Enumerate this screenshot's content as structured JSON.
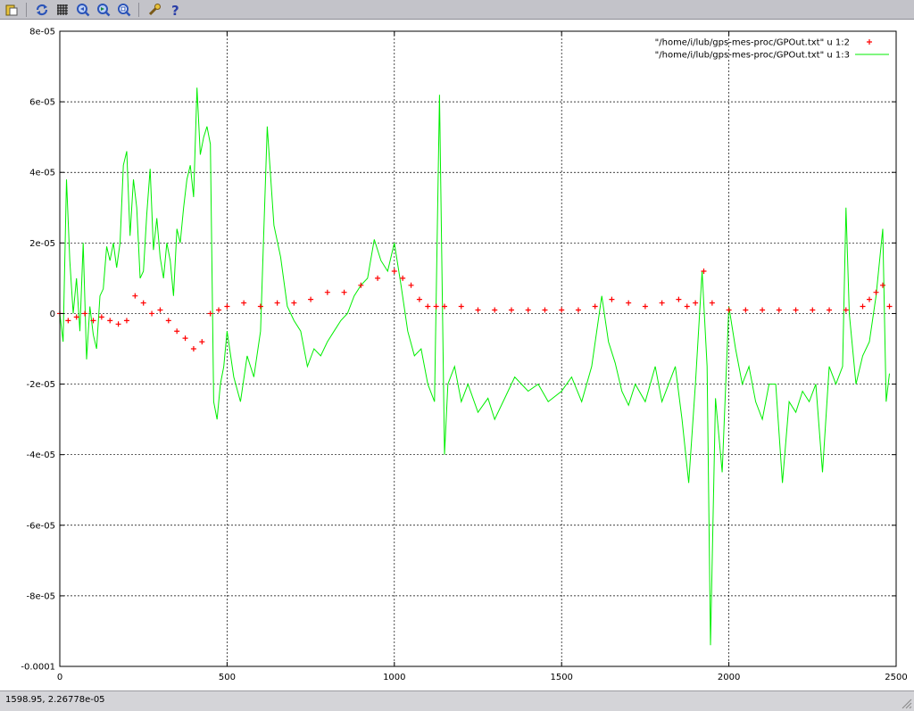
{
  "toolbar": {
    "buttons": [
      {
        "name": "copy-to-clipboard-icon"
      },
      {
        "name": "replot-icon"
      },
      {
        "name": "grid-icon"
      },
      {
        "name": "zoom-previous-icon"
      },
      {
        "name": "zoom-next-icon"
      },
      {
        "name": "zoom-unzoom-icon"
      },
      {
        "name": "options-icon"
      },
      {
        "name": "help-icon"
      }
    ],
    "colors": {
      "background": "#c3c3c9",
      "icon_blue": "#2b54b8",
      "icon_yellow": "#e8c23a"
    }
  },
  "status": {
    "coords": "1598.95,  2.26778e-05"
  },
  "chart_data": {
    "type": "line",
    "xlim": [
      0,
      2500
    ],
    "ylim": [
      -0.0001,
      8e-05
    ],
    "x_ticks": [
      "0",
      "500",
      "1000",
      "1500",
      "2000",
      "2500"
    ],
    "y_ticks": [
      "-0.0001",
      "-8e-05",
      "-6e-05",
      "-4e-05",
      "-2e-05",
      "0",
      "2e-05",
      "4e-05",
      "6e-05",
      "8e-05"
    ],
    "grid": true,
    "legend_position": "top-right",
    "series": [
      {
        "name": "\"/home/i/lub/gps-mes-proc/GPOut.txt\" u 1:2",
        "style": "points",
        "marker": "+",
        "color": "#ff0000",
        "x": [
          0,
          25,
          50,
          75,
          100,
          125,
          150,
          175,
          200,
          225,
          250,
          275,
          300,
          325,
          350,
          375,
          400,
          425,
          450,
          475,
          500,
          550,
          600,
          650,
          700,
          750,
          800,
          850,
          900,
          950,
          1000,
          1025,
          1050,
          1075,
          1100,
          1125,
          1150,
          1200,
          1250,
          1300,
          1350,
          1400,
          1450,
          1500,
          1550,
          1600,
          1650,
          1700,
          1750,
          1800,
          1850,
          1875,
          1900,
          1925,
          1950,
          2000,
          2050,
          2100,
          2150,
          2200,
          2250,
          2300,
          2350,
          2400,
          2420,
          2440,
          2460,
          2480
        ],
        "y": [
          0,
          -2e-06,
          -1e-06,
          0,
          -2e-06,
          -1e-06,
          -2e-06,
          -3e-06,
          -2e-06,
          5e-06,
          3e-06,
          0,
          1e-06,
          -2e-06,
          -5e-06,
          -7e-06,
          -1e-05,
          -8e-06,
          0,
          1e-06,
          2e-06,
          3e-06,
          2e-06,
          3e-06,
          3e-06,
          4e-06,
          6e-06,
          6e-06,
          8e-06,
          1e-05,
          1.2e-05,
          1e-05,
          8e-06,
          4e-06,
          2e-06,
          2e-06,
          2e-06,
          2e-06,
          1e-06,
          1e-06,
          1e-06,
          1e-06,
          1e-06,
          1e-06,
          1e-06,
          2e-06,
          4e-06,
          3e-06,
          2e-06,
          3e-06,
          4e-06,
          2e-06,
          3e-06,
          1.2e-05,
          3e-06,
          1e-06,
          1e-06,
          1e-06,
          1e-06,
          1e-06,
          1e-06,
          1e-06,
          1e-06,
          2e-06,
          4e-06,
          6e-06,
          8e-06,
          2e-06
        ]
      },
      {
        "name": "\"/home/i/lub/gps-mes-proc/GPOut.txt\" u 1:3",
        "style": "lines",
        "color": "#00ee00",
        "x": [
          0,
          10,
          20,
          30,
          40,
          50,
          60,
          70,
          80,
          90,
          100,
          110,
          120,
          130,
          140,
          150,
          160,
          170,
          180,
          190,
          200,
          210,
          220,
          230,
          240,
          250,
          260,
          270,
          280,
          290,
          300,
          310,
          320,
          330,
          340,
          350,
          360,
          370,
          380,
          390,
          400,
          410,
          420,
          430,
          440,
          450,
          460,
          470,
          480,
          490,
          500,
          520,
          540,
          560,
          580,
          600,
          620,
          640,
          660,
          680,
          700,
          720,
          740,
          760,
          780,
          800,
          820,
          840,
          860,
          880,
          900,
          920,
          940,
          960,
          980,
          1000,
          1020,
          1040,
          1060,
          1080,
          1100,
          1120,
          1135,
          1150,
          1160,
          1180,
          1200,
          1220,
          1250,
          1280,
          1300,
          1330,
          1360,
          1400,
          1430,
          1460,
          1500,
          1530,
          1560,
          1590,
          1620,
          1640,
          1660,
          1680,
          1700,
          1720,
          1750,
          1780,
          1800,
          1820,
          1840,
          1860,
          1880,
          1900,
          1920,
          1935,
          1945,
          1960,
          1980,
          2000,
          2020,
          2040,
          2060,
          2080,
          2100,
          2120,
          2140,
          2160,
          2180,
          2200,
          2220,
          2240,
          2260,
          2280,
          2300,
          2320,
          2340,
          2350,
          2360,
          2380,
          2400,
          2420,
          2440,
          2460,
          2470,
          2480
        ],
        "y": [
          0,
          -8e-06,
          3.8e-05,
          1.5e-05,
          0,
          1e-05,
          -5e-06,
          2e-05,
          -1.3e-05,
          2e-06,
          -6e-06,
          -1e-05,
          5e-06,
          7e-06,
          1.9e-05,
          1.5e-05,
          2e-05,
          1.3e-05,
          2e-05,
          4.2e-05,
          4.6e-05,
          2.2e-05,
          3.8e-05,
          3e-05,
          1e-05,
          1.2e-05,
          2.8e-05,
          4.1e-05,
          1.8e-05,
          2.7e-05,
          1.6e-05,
          1e-05,
          2e-05,
          1.5e-05,
          5e-06,
          2.4e-05,
          2e-05,
          3e-05,
          3.8e-05,
          4.2e-05,
          3.3e-05,
          6.4e-05,
          4.5e-05,
          5e-05,
          5.3e-05,
          4.8e-05,
          -2.5e-05,
          -3e-05,
          -2e-05,
          -1.5e-05,
          -5e-06,
          -1.8e-05,
          -2.5e-05,
          -1.2e-05,
          -1.8e-05,
          -5e-06,
          5.3e-05,
          2.5e-05,
          1.6e-05,
          2e-06,
          -2e-06,
          -5e-06,
          -1.5e-05,
          -1e-05,
          -1.2e-05,
          -8e-06,
          -5e-06,
          -2e-06,
          0,
          5e-06,
          8e-06,
          1e-05,
          2.1e-05,
          1.5e-05,
          1.2e-05,
          2e-05,
          8e-06,
          -5e-06,
          -1.2e-05,
          -1e-05,
          -2e-05,
          -2.5e-05,
          6.2e-05,
          -4e-05,
          -2e-05,
          -1.5e-05,
          -2.5e-05,
          -2e-05,
          -2.8e-05,
          -2.4e-05,
          -3e-05,
          -2.4e-05,
          -1.8e-05,
          -2.2e-05,
          -2e-05,
          -2.5e-05,
          -2.2e-05,
          -1.8e-05,
          -2.5e-05,
          -1.5e-05,
          5e-06,
          -8e-06,
          -1.4e-05,
          -2.2e-05,
          -2.6e-05,
          -2e-05,
          -2.5e-05,
          -1.5e-05,
          -2.5e-05,
          -2e-05,
          -1.5e-05,
          -3e-05,
          -4.8e-05,
          -2e-05,
          1.2e-05,
          -1.5e-05,
          -9.4e-05,
          -2.4e-05,
          -4.5e-05,
          2e-06,
          -1e-05,
          -2e-05,
          -1.5e-05,
          -2.5e-05,
          -3e-05,
          -2e-05,
          -2e-05,
          -4.8e-05,
          -2.5e-05,
          -2.8e-05,
          -2.2e-05,
          -2.5e-05,
          -2e-05,
          -4.5e-05,
          -1.5e-05,
          -2e-05,
          -1.5e-05,
          3e-05,
          0,
          -2e-05,
          -1.2e-05,
          -8e-06,
          5e-06,
          2.4e-05,
          -2.5e-05,
          -1.7e-05
        ]
      }
    ]
  }
}
